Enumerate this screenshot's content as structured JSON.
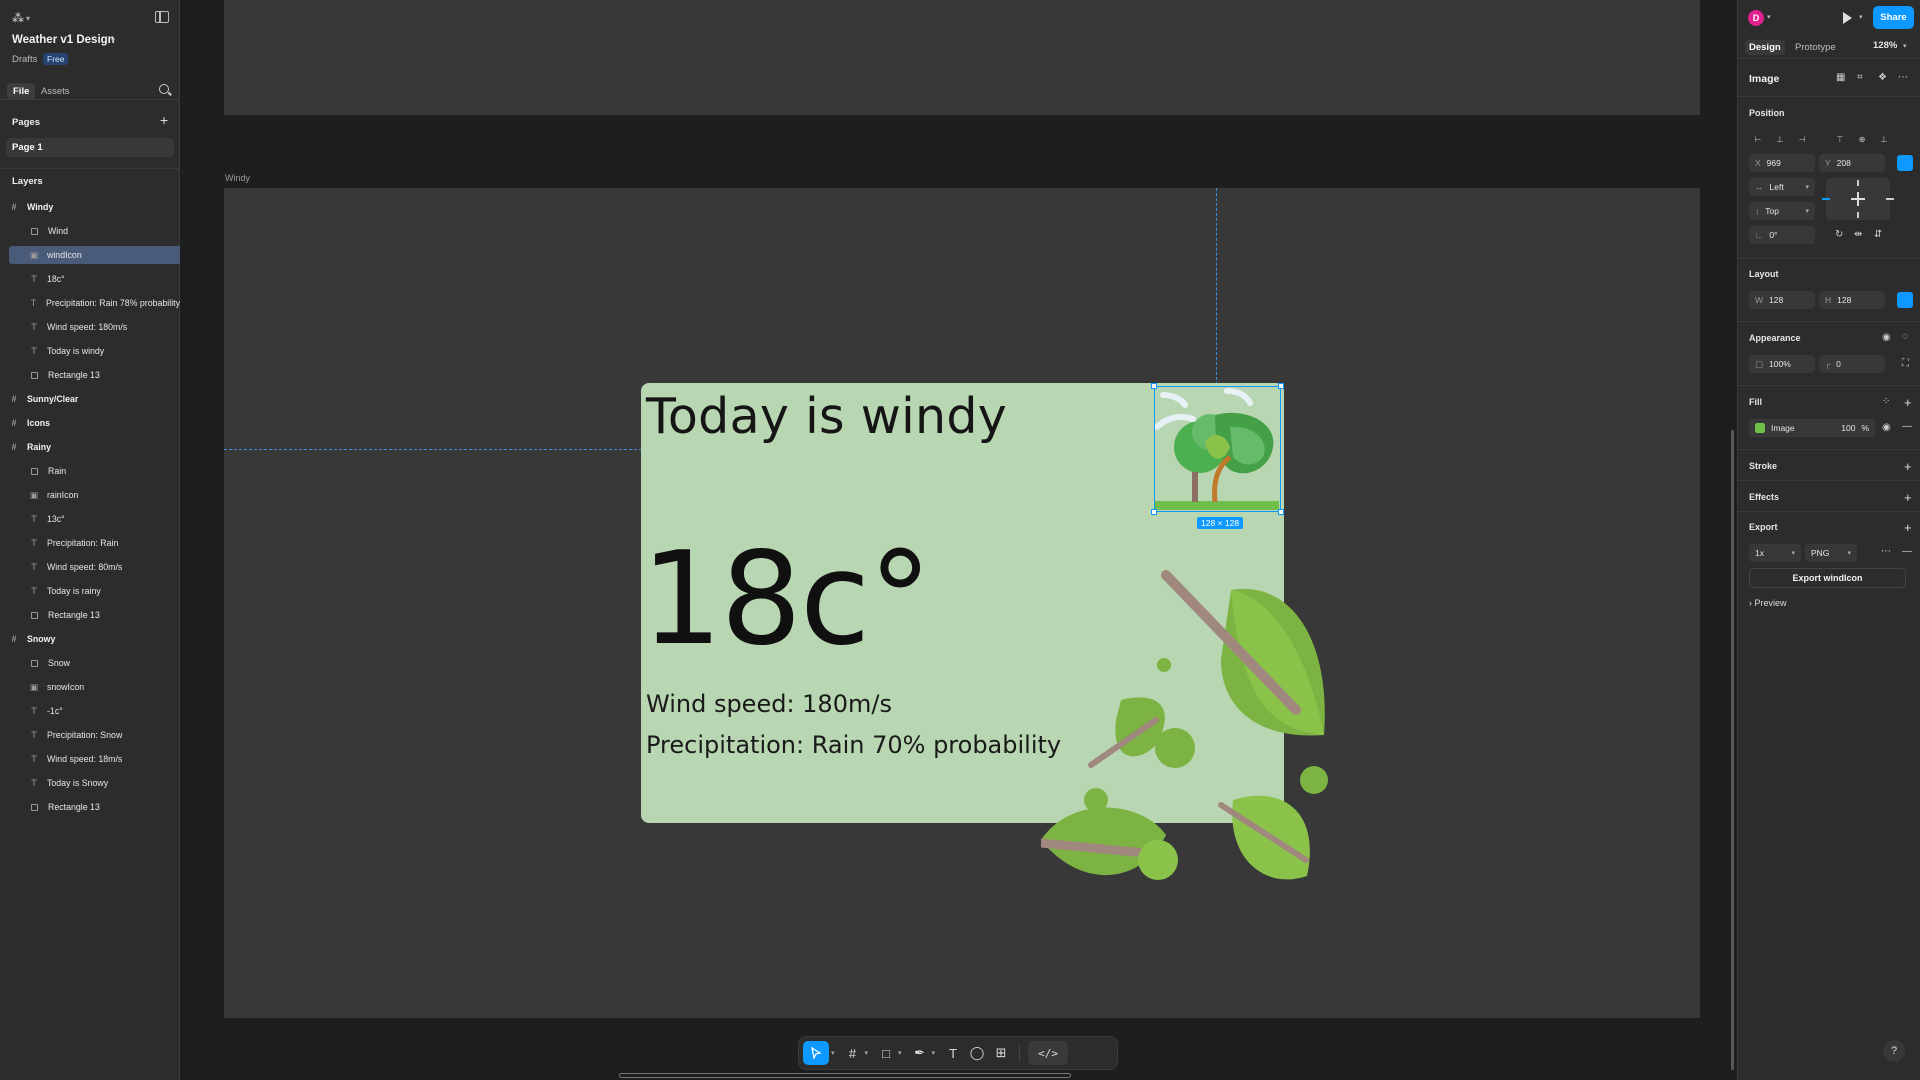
{
  "app": {
    "file_name": "Weather v1 Design",
    "location": "Drafts",
    "plan_badge": "Free"
  },
  "left_tabs": [
    "File",
    "Assets"
  ],
  "pages": {
    "title": "Pages",
    "items": [
      "Page 1"
    ]
  },
  "layers": {
    "title": "Layers",
    "items": [
      {
        "label": "Windy",
        "kind": "group"
      },
      {
        "label": "Wind",
        "kind": "rect"
      },
      {
        "label": "windIcon",
        "kind": "image",
        "selected": true
      },
      {
        "label": "18c°",
        "kind": "text"
      },
      {
        "label": "Precipitation: Rain 78% probability",
        "kind": "text"
      },
      {
        "label": "Wind speed: 180m/s",
        "kind": "text"
      },
      {
        "label": "Today is windy",
        "kind": "text"
      },
      {
        "label": "Rectangle 13",
        "kind": "rect"
      },
      {
        "label": "Sunny/Clear",
        "kind": "group"
      },
      {
        "label": "Icons",
        "kind": "group"
      },
      {
        "label": "Rainy",
        "kind": "group"
      },
      {
        "label": "Rain",
        "kind": "rect"
      },
      {
        "label": "rainIcon",
        "kind": "image"
      },
      {
        "label": "13c°",
        "kind": "text"
      },
      {
        "label": "Precipitation: Rain",
        "kind": "text"
      },
      {
        "label": "Wind speed: 80m/s",
        "kind": "text"
      },
      {
        "label": "Today is rainy",
        "kind": "text"
      },
      {
        "label": "Rectangle 13",
        "kind": "rect"
      },
      {
        "label": "Snowy",
        "kind": "group"
      },
      {
        "label": "Snow",
        "kind": "rect"
      },
      {
        "label": "snowIcon",
        "kind": "image"
      },
      {
        "label": "-1c°",
        "kind": "text"
      },
      {
        "label": "Precipitation: Snow",
        "kind": "text"
      },
      {
        "label": "Wind speed: 18m/s",
        "kind": "text"
      },
      {
        "label": "Today is Snowy",
        "kind": "text"
      },
      {
        "label": "Rectangle 13",
        "kind": "rect"
      }
    ]
  },
  "canvas": {
    "frame_label": "Windy",
    "card": {
      "heading": "Today is windy",
      "temperature": "18c°",
      "wind": "Wind speed: 180m/s",
      "precipitation": "Precipitation: Rain 70% probability",
      "background_color": "#b8d6b2"
    },
    "selection_size": "128 × 128"
  },
  "right": {
    "avatar_letter": "D",
    "share_label": "Share",
    "tabs": [
      "Design",
      "Prototype"
    ],
    "zoom": "128%",
    "layer_type": "Image",
    "position": {
      "title": "Position",
      "x_label": "X",
      "x": "969",
      "y_label": "Y",
      "y": "208",
      "h_constraint": "Left",
      "v_constraint": "Top",
      "rotation": "0°"
    },
    "layout": {
      "title": "Layout",
      "w_label": "W",
      "w": "128",
      "h_label": "H",
      "h": "128"
    },
    "appearance": {
      "title": "Appearance",
      "opacity": "100%",
      "radius": "0"
    },
    "fill": {
      "title": "Fill",
      "type": "Image",
      "opacity": "100",
      "unit": "%"
    },
    "stroke_title": "Stroke",
    "effects_title": "Effects",
    "export": {
      "title": "Export",
      "scale": "1x",
      "format": "PNG",
      "button": "Export windIcon",
      "preview": "Preview"
    }
  },
  "colors": {
    "accent": "#0d99ff",
    "panel": "#2c2c2c",
    "canvas": "#1e1e1e",
    "frame": "#383838"
  }
}
